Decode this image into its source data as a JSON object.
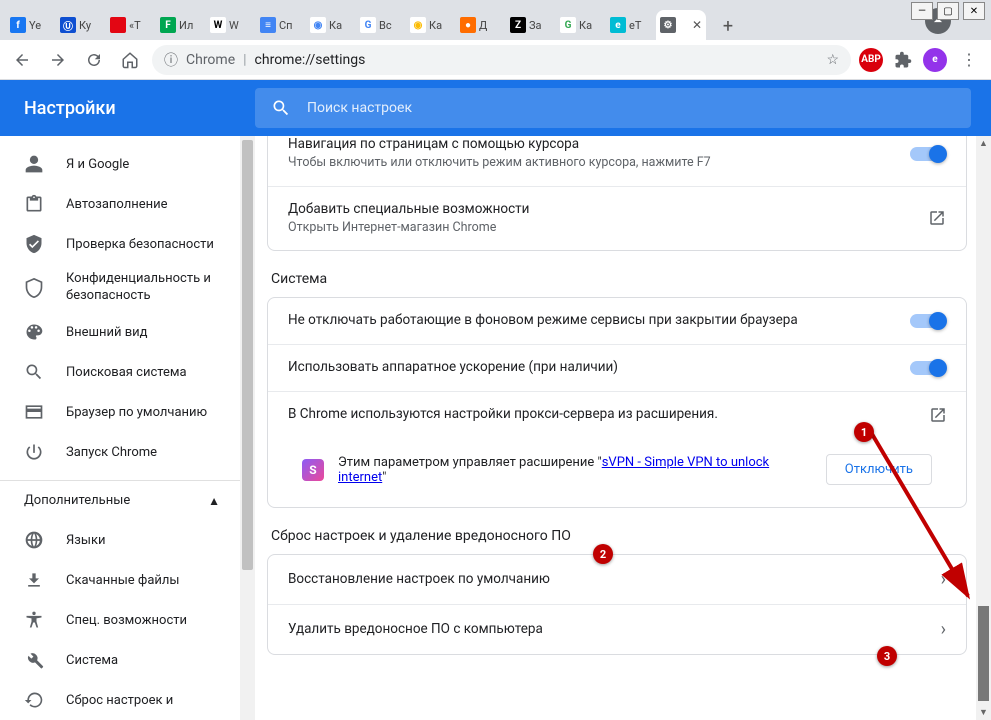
{
  "window": {
    "min": "—",
    "max": "▢",
    "close": "✕"
  },
  "tabs": [
    {
      "title": "Ye",
      "fav_bg": "#1877f2",
      "fav_txt": "f",
      "fav_color": "#fff"
    },
    {
      "title": "Ку",
      "fav_bg": "#0e4fd1",
      "fav_txt": "Ⓤ",
      "fav_color": "#fff"
    },
    {
      "title": "«Т",
      "fav_bg": "#e30613",
      "fav_txt": " ",
      "fav_color": "#fff"
    },
    {
      "title": "Ил",
      "fav_bg": "#00a651",
      "fav_txt": "F",
      "fav_color": "#fff"
    },
    {
      "title": "W",
      "fav_bg": "#ffffff",
      "fav_txt": "W",
      "fav_color": "#000"
    },
    {
      "title": "Сп",
      "fav_bg": "#4285f4",
      "fav_txt": "≡",
      "fav_color": "#fff"
    },
    {
      "title": "Ка",
      "fav_bg": "#ffffff",
      "fav_txt": "◉",
      "fav_color": "#4285f4"
    },
    {
      "title": "Вс",
      "fav_bg": "#ffffff",
      "fav_txt": "G",
      "fav_color": "#4285f4"
    },
    {
      "title": "Ка",
      "fav_bg": "#ffffff",
      "fav_txt": "◉",
      "fav_color": "#fbbc04"
    },
    {
      "title": "Д",
      "fav_bg": "#ff6d00",
      "fav_txt": "●",
      "fav_color": "#fff"
    },
    {
      "title": "За",
      "fav_bg": "#000000",
      "fav_txt": "Z",
      "fav_color": "#fff"
    },
    {
      "title": "Ка",
      "fav_bg": "#ffffff",
      "fav_txt": "G",
      "fav_color": "#34a853"
    },
    {
      "title": "eT",
      "fav_bg": "#00bcd4",
      "fav_txt": "e",
      "fav_color": "#fff"
    },
    {
      "title": "",
      "fav_bg": "#5f6368",
      "fav_txt": "⚙",
      "fav_color": "#fff",
      "active": true
    }
  ],
  "omnibox": {
    "scheme_icon": "ⓘ",
    "chip": "Chrome",
    "url": "chrome://settings"
  },
  "ext_icons": {
    "abp": "ABP",
    "avatar_letter": "е"
  },
  "settings": {
    "header_title": "Настройки",
    "search_placeholder": "Поиск настроек"
  },
  "sidebar": {
    "items": [
      {
        "label": "Я и Google",
        "icon": "person"
      },
      {
        "label": "Автозаполнение",
        "icon": "clipboard"
      },
      {
        "label": "Проверка безопасности",
        "icon": "shield-check"
      },
      {
        "label": "Конфиденциальность и безопасность",
        "icon": "shield",
        "multiline": true
      },
      {
        "label": "Внешний вид",
        "icon": "palette"
      },
      {
        "label": "Поисковая система",
        "icon": "search"
      },
      {
        "label": "Браузер по умолчанию",
        "icon": "browser"
      },
      {
        "label": "Запуск Chrome",
        "icon": "power"
      }
    ],
    "advanced_label": "Дополнительные",
    "adv_items": [
      {
        "label": "Языки",
        "icon": "globe"
      },
      {
        "label": "Скачанные файлы",
        "icon": "download"
      },
      {
        "label": "Спец. возможности",
        "icon": "accessibility"
      },
      {
        "label": "Система",
        "icon": "wrench"
      },
      {
        "label": "Сброс настроек и",
        "icon": "restore",
        "partial": true
      }
    ]
  },
  "sections": {
    "a11y": {
      "caret_title": "Навигация по страницам с помощью курсора",
      "caret_sub": "Чтобы включить или отключить режим активного курсора, нажмите F7",
      "add_title": "Добавить специальные возможности",
      "add_sub": "Открыть Интернет-магазин Chrome"
    },
    "system": {
      "heading": "Система",
      "bg_title": "Не отключать работающие в фоновом режиме сервисы при закрытии браузера",
      "hw_title": "Использовать аппаратное ускорение (при наличии)",
      "proxy_title": "В Chrome используются настройки прокси-сервера из расширения.",
      "proxy_msg_prefix": "Этим параметром управляет расширение \"",
      "proxy_link": "sVPN - Simple VPN to unlock internet",
      "proxy_msg_suffix": "\"",
      "disable_btn": "Отключить"
    },
    "reset": {
      "heading": "Сброс настроек и удаление вредоносного ПО",
      "restore": "Восстановление настроек по умолчанию",
      "cleanup": "Удалить вредоносное ПО с компьютера"
    }
  },
  "annotations": {
    "n1": "1",
    "n2": "2",
    "n3": "3"
  }
}
